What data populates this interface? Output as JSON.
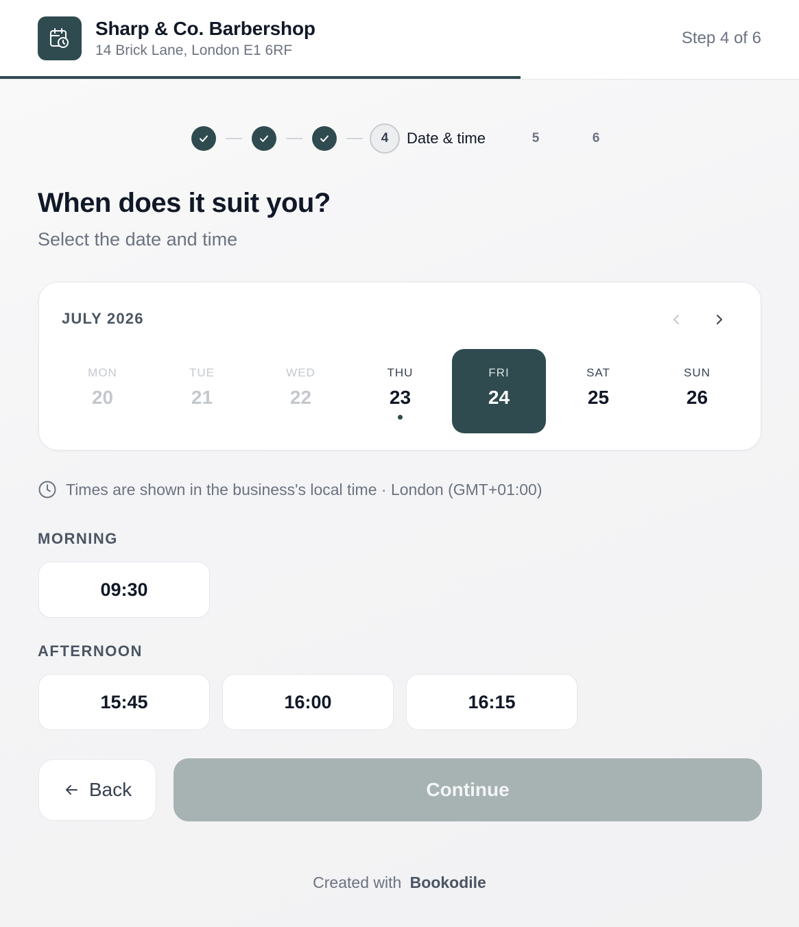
{
  "header": {
    "business_name": "Sharp & Co. Barbershop",
    "business_address": "14 Brick Lane, London E1 6RF",
    "step_label": "Step 4 of 6",
    "progress_fraction": 0.6667,
    "logo_icon": "calendar-clock-icon"
  },
  "stepper": {
    "completed_steps": 3,
    "current_number": "4",
    "current_label": "Date & time",
    "future_steps": [
      "5",
      "6"
    ]
  },
  "page": {
    "title": "When does it suit you?",
    "subtitle": "Select the date and time"
  },
  "calendar": {
    "month_label": "JULY 2026",
    "days": [
      {
        "dow": "MON",
        "num": "20",
        "state": "past"
      },
      {
        "dow": "TUE",
        "num": "21",
        "state": "past"
      },
      {
        "dow": "WED",
        "num": "22",
        "state": "past"
      },
      {
        "dow": "THU",
        "num": "23",
        "state": "today"
      },
      {
        "dow": "FRI",
        "num": "24",
        "state": "selected"
      },
      {
        "dow": "SAT",
        "num": "25",
        "state": "available"
      },
      {
        "dow": "SUN",
        "num": "26",
        "state": "available"
      }
    ]
  },
  "timezone_note": "Times are shown in the business's local time · London (GMT+01:00)",
  "morning": {
    "label": "MORNING",
    "slots": [
      "09:30"
    ]
  },
  "afternoon": {
    "label": "AFTERNOON",
    "slots": [
      "15:45",
      "16:00",
      "16:15"
    ]
  },
  "actions": {
    "back_label": "Back",
    "continue_label": "Continue"
  },
  "footer": {
    "prefix": "Created with",
    "brand": "Bookodile"
  },
  "colors": {
    "primary": "#2f4b4f",
    "continue_disabled": "#a7b2b3"
  }
}
